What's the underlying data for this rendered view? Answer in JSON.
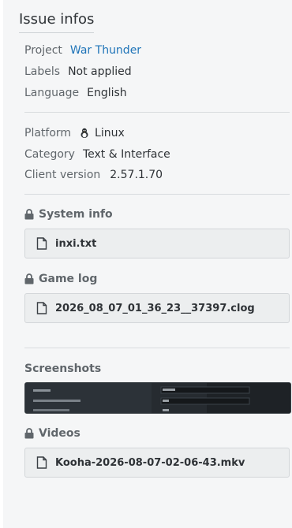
{
  "title": "Issue infos",
  "project": {
    "label": "Project",
    "value": "War Thunder"
  },
  "labels": {
    "label": "Labels",
    "value": "Not applied"
  },
  "language": {
    "label": "Language",
    "value": "English"
  },
  "platform": {
    "label": "Platform",
    "value": "Linux",
    "icon": "linux-icon"
  },
  "category": {
    "label": "Category",
    "value": "Text & Interface"
  },
  "client_version": {
    "label": "Client version",
    "value": "2.57.1.70"
  },
  "system_info": {
    "label": "System info",
    "file": "inxi.txt"
  },
  "game_log": {
    "label": "Game log",
    "file": "2026_08_07_01_36_23__37397.clog"
  },
  "screenshots": {
    "label": "Screenshots"
  },
  "videos": {
    "label": "Videos",
    "file": "Kooha-2026-08-07-02-06-43.mkv"
  }
}
